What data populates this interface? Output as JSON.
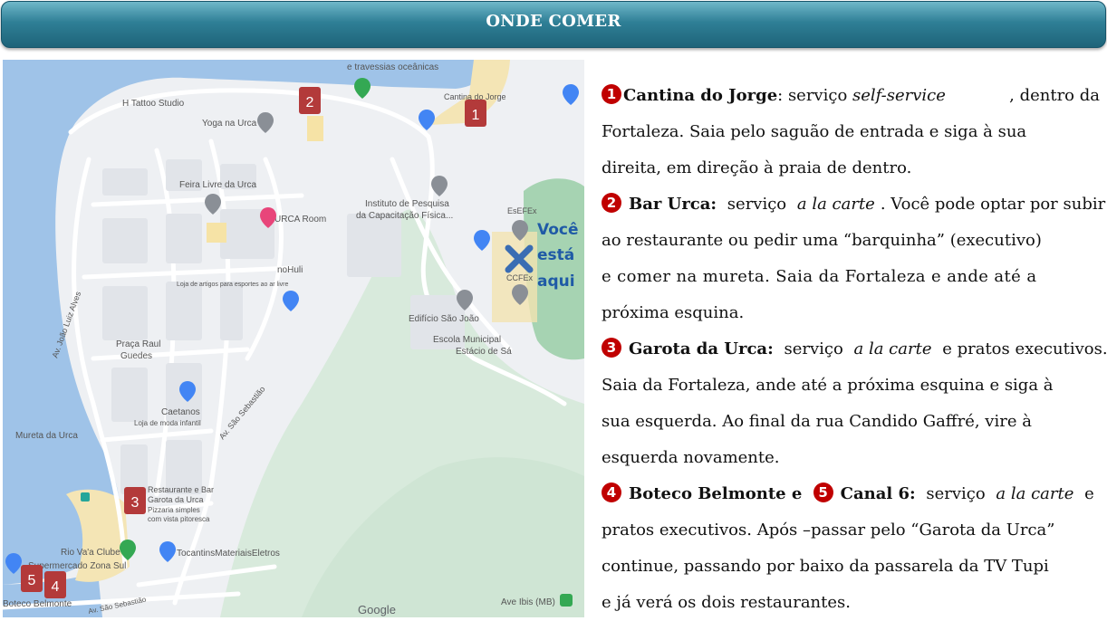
{
  "header": {
    "title": "ONDE COMER"
  },
  "map": {
    "labels": {
      "travessias": "e travessias oceânicas",
      "tattoo": "H Tattoo Studio",
      "yoga": "Yoga na Urca",
      "cantina": "Cantina do Jorge",
      "feira": "Feira Livre da Urca",
      "instituto": "Instituto de Pesquisa",
      "instituto2": "da Capacitação Física...",
      "urca_room": "URCA Room",
      "esefex": "EsEFEx",
      "ccfex": "CCFEx",
      "nohuli": "noHuli",
      "loja_artigos": "Loja de artigos para esportes ao ar livre",
      "edificio": "Edifício São João",
      "escola": "Escola Municipal",
      "escola2": "Estácio de Sá",
      "praca": "Praça Raul",
      "praca2": "Guedes",
      "av_joao": "Av. João Luiz Alves",
      "av_sao": "Av. São Sebastião",
      "av_sao2": "Av. São Sebastião",
      "caetanos": "Caetanos",
      "caetanos2": "Loja de moda infantil",
      "mureta": "Mureta da Urca",
      "rest_bar": "Restaurante e Bar",
      "rest_bar2": "Garota da Urca",
      "rest_bar3": "Pizzaria simples",
      "rest_bar4": "com vista pitoresca",
      "rio_vaa": "Rio Va'a Clube",
      "supermercado": "Supermercado Zona Sul",
      "tocantins": "TocantinsMateriaisEletros",
      "boteco": "Boteco Belmonte",
      "google": "Google",
      "ave": "Ave Ibis (MB)",
      "voce1": "Você",
      "voce2": "está",
      "voce3": "aqui"
    },
    "markers": [
      "1",
      "2",
      "3",
      "4",
      "5"
    ]
  },
  "content": {
    "p1": {
      "num": "1",
      "line1": [
        "Cantina do Jorge",
        ": serviço ",
        "self-service",
        ", dentro da"
      ],
      "line2": "Fortaleza. Saia pelo saguão de entrada e siga à sua",
      "line3": "direita, em direção à praia de dentro."
    },
    "p2": {
      "num": "2",
      "line1": [
        "Bar Urca:",
        " serviço ",
        "a la carte",
        ". Você pode optar por subir"
      ],
      "line2": "ao restaurante ou pedir uma “barquinha” (executivo)",
      "line3": "e comer na mureta. Saia da Fortaleza e ande até a",
      "line4": "próxima esquina."
    },
    "p3": {
      "num": "3",
      "line1": [
        "Garota da Urca:",
        " serviço ",
        "a la carte",
        " e pratos executivos."
      ],
      "line2": "Saia da Fortaleza, ande até a próxima esquina e siga à",
      "line3": "sua esquerda. Ao final da rua Candido Gaffré, vire à",
      "line4": "esquerda novamente."
    },
    "p4": {
      "num4": "4",
      "name4": "Boteco Belmonte e ",
      "num5": "5",
      "name5": "Canal 6:",
      "rest": " serviço ",
      "italic": "a la carte",
      "end": " e",
      "line2": "pratos executivos. Após –passar pelo “Garota da Urca”",
      "line3": "continue, passando por baixo da passarela da TV Tupi",
      "line4": "e já verá os dois restaurantes."
    }
  }
}
